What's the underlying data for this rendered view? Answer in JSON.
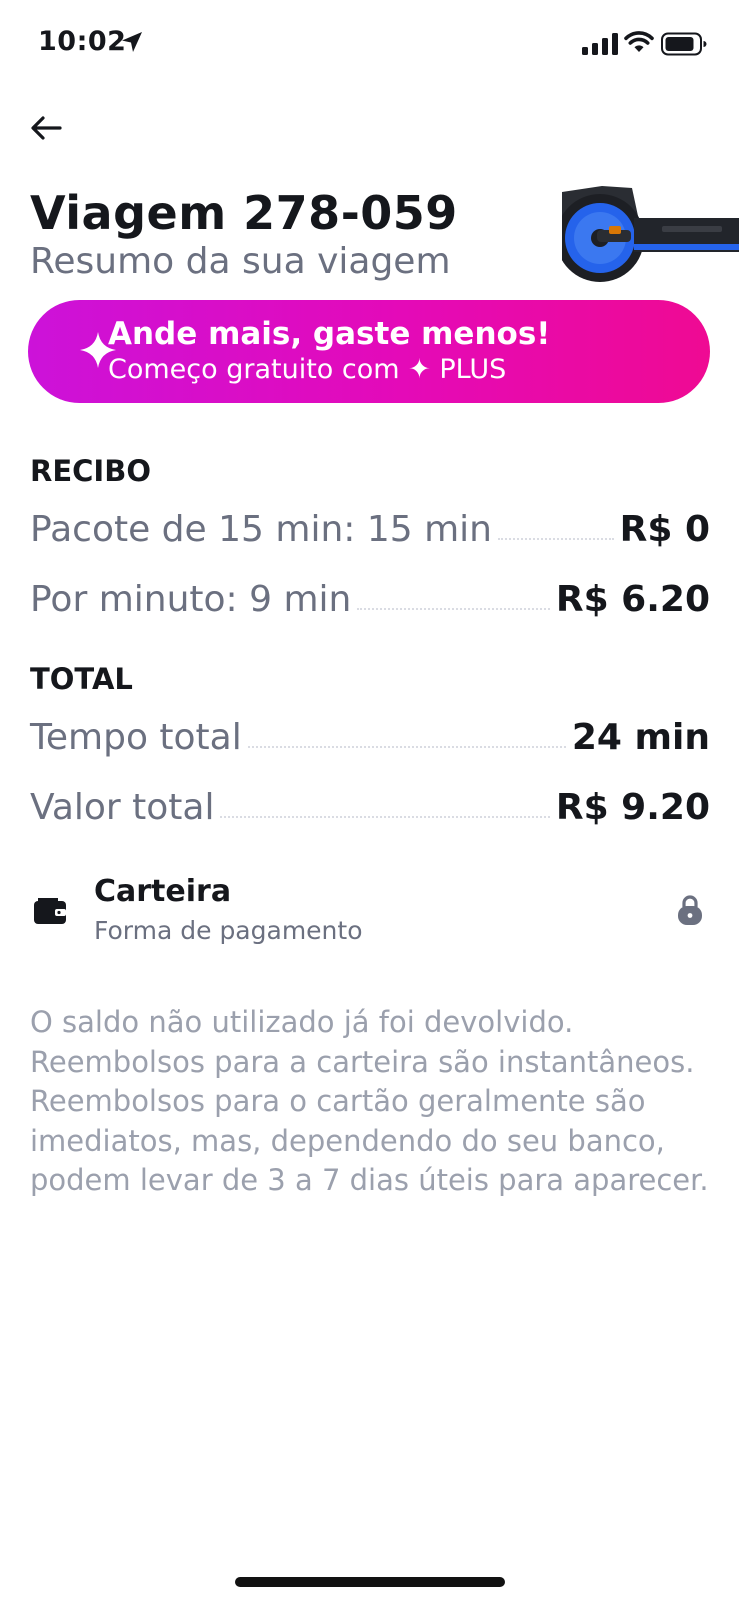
{
  "status_bar": {
    "time": "10:02",
    "icons": [
      "location-arrow-icon",
      "cellular-signal-icon",
      "wifi-icon",
      "battery-icon"
    ]
  },
  "header": {
    "back_icon": "arrow-left-icon",
    "title": "Viagem 278-059",
    "subtitle": "Resumo da sua viagem"
  },
  "banner": {
    "title": "Ande mais, gaste menos!",
    "subtitle": "Começo gratuito com ✦ PLUS",
    "icon": "sparkle-icon",
    "gradient": [
      "#cc12d9",
      "#ef0a93"
    ]
  },
  "receipt": {
    "heading": "RECIBO",
    "items": [
      {
        "label": "Pacote de 15 min: 15 min",
        "value": "R$ 0"
      },
      {
        "label": "Por minuto: 9 min",
        "value": "R$ 6.20"
      }
    ]
  },
  "total": {
    "heading": "TOTAL",
    "items": [
      {
        "label": "Tempo total",
        "value": "24 min"
      },
      {
        "label": "Valor total",
        "value": "R$ 9.20"
      }
    ]
  },
  "payment": {
    "icon": "wallet-icon",
    "title": "Carteira",
    "subtitle": "Forma de pagamento",
    "status_icon": "lock-icon"
  },
  "info": "O saldo não utilizado já foi devolvido. Reembolsos para a carteira são instantâneos. Reembolsos para o cartão geralmente são imediatos, mas, dependendo do seu banco, podem levar de 3 a 7 dias úteis para aparecer.",
  "colors": {
    "text_primary": "#15171c",
    "text_secondary": "#6b7080",
    "text_muted": "#9ba0ad",
    "scooter_accent": "#2563eb"
  }
}
